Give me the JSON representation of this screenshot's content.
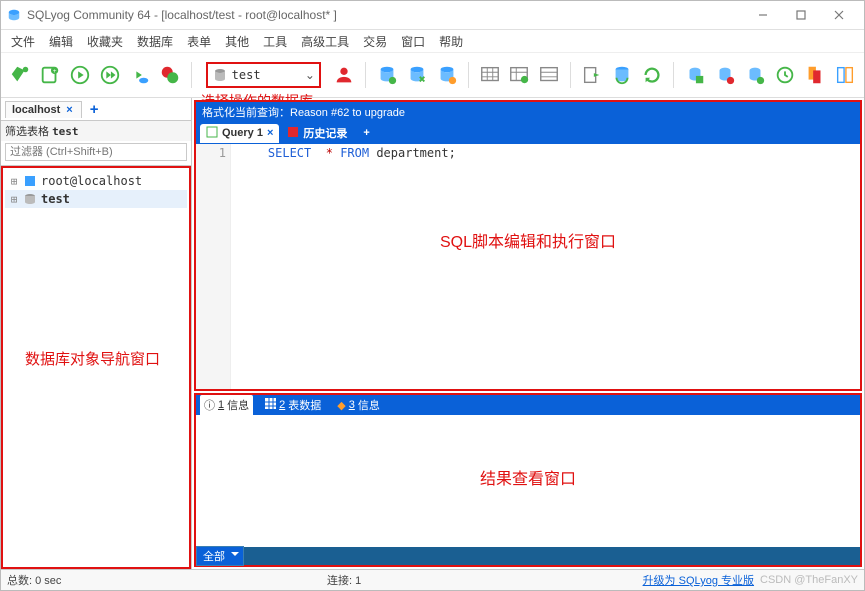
{
  "title": "SQLyog Community 64 - [localhost/test - root@localhost* ]",
  "menu": [
    "文件",
    "编辑",
    "收藏夹",
    "数据库",
    "表单",
    "其他",
    "工具",
    "高级工具",
    "交易",
    "窗口",
    "帮助"
  ],
  "db_select": {
    "name": "test"
  },
  "annot": {
    "db": "选择操作的数据库",
    "tree": "数据库对象导航窗口",
    "editor": "SQL脚本编辑和执行窗口",
    "result": "结果查看窗口"
  },
  "conn_tab": {
    "label": "localhost",
    "close": "×",
    "add": "+"
  },
  "filter": {
    "head_prefix": "筛选表格 ",
    "head_db": "test",
    "placeholder": "过滤器 (Ctrl+Shift+B)"
  },
  "tree": {
    "root": "root@localhost",
    "db": "test"
  },
  "fmt_bar": "格式化当前查询：Reason #62 to upgrade",
  "qtabs": {
    "q1": "Query 1",
    "hist": "历史记录",
    "add": "+"
  },
  "code": {
    "line": "1",
    "k1": "SELECT",
    "star": "*",
    "k2": "FROM",
    "rest": "department;"
  },
  "rtabs": {
    "n1": "1",
    "l1": "信息",
    "n2": "2",
    "l2": "表数据",
    "n3": "3",
    "l3": "信息"
  },
  "bottom_select": "全部",
  "status": {
    "total": "总数: 0 sec",
    "conn": "连接: 1",
    "link": "升级为 SQLyog 专业版",
    "watermark": "CSDN @TheFanXY"
  }
}
